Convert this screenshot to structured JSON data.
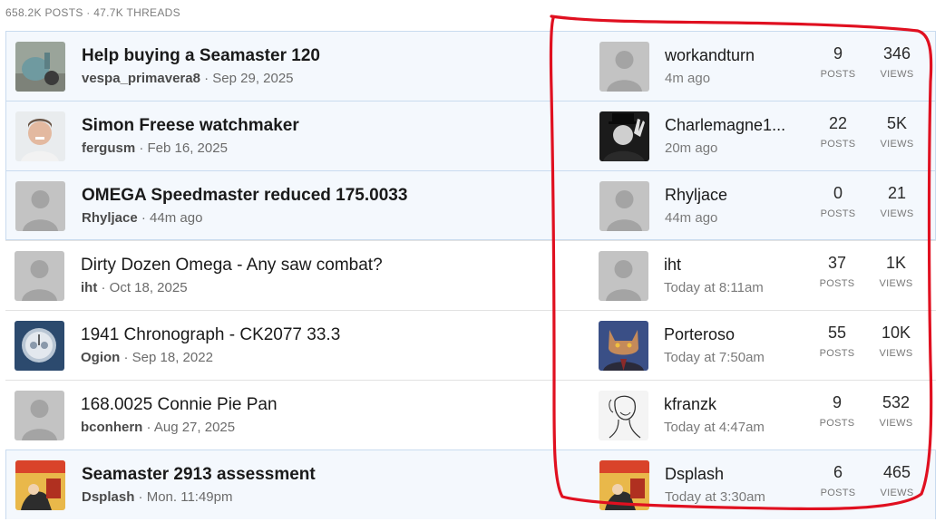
{
  "header": {
    "stats": "658.2K POSTS · 47.7K THREADS"
  },
  "labels": {
    "posts": "POSTS",
    "views": "VIEWS"
  },
  "threads": [
    {
      "title": "Help buying a Seamaster 120",
      "author": "vespa_primavera8",
      "date": "· Sep 29, 2025",
      "last_user": "workandturn",
      "last_time": "4m ago",
      "posts": "9",
      "views": "346",
      "unread": true,
      "avatar": "scooter-photo",
      "last_avatar": "default-avatar"
    },
    {
      "title": "Simon Freese watchmaker",
      "author": "fergusm",
      "date": "· Feb 16, 2025",
      "last_user": "Charlemagne1...",
      "last_time": "20m ago",
      "posts": "22",
      "views": "5K",
      "unread": true,
      "avatar": "portrait-photo",
      "last_avatar": "bw-victory-photo"
    },
    {
      "title": "OMEGA Speedmaster reduced 175.0033",
      "author": "Rhyljace",
      "date": "· 44m ago",
      "last_user": "Rhyljace",
      "last_time": "44m ago",
      "posts": "0",
      "views": "21",
      "unread": true,
      "avatar": "default-avatar",
      "last_avatar": "default-avatar"
    },
    {
      "title": "Dirty Dozen Omega - Any saw combat?",
      "author": "iht",
      "date": "· Oct 18, 2025",
      "last_user": "iht",
      "last_time": "Today at 8:11am",
      "posts": "37",
      "views": "1K",
      "unread": false,
      "avatar": "default-avatar",
      "last_avatar": "default-avatar"
    },
    {
      "title": "1941 Chronograph - CK2077 33.3",
      "author": "Ogion",
      "date": "· Sep 18, 2022",
      "last_user": "Porteroso",
      "last_time": "Today at 7:50am",
      "posts": "55",
      "views": "10K",
      "unread": false,
      "avatar": "watch-photo",
      "last_avatar": "cat-suit-image"
    },
    {
      "title": "168.0025 Connie Pie Pan",
      "author": "bconhern",
      "date": "· Aug 27, 2025",
      "last_user": "kfranzk",
      "last_time": "Today at 4:47am",
      "posts": "9",
      "views": "532",
      "unread": false,
      "avatar": "default-avatar",
      "last_avatar": "sketch-portrait"
    },
    {
      "title": "Seamaster 2913 assessment",
      "author": "Dsplash",
      "date": "· Mon. 11:49pm",
      "last_user": "Dsplash",
      "last_time": "Today at 3:30am",
      "posts": "6",
      "views": "465",
      "unread": true,
      "avatar": "comic-image",
      "last_avatar": "comic-image"
    }
  ],
  "annotation": {
    "color": "#e01020"
  }
}
